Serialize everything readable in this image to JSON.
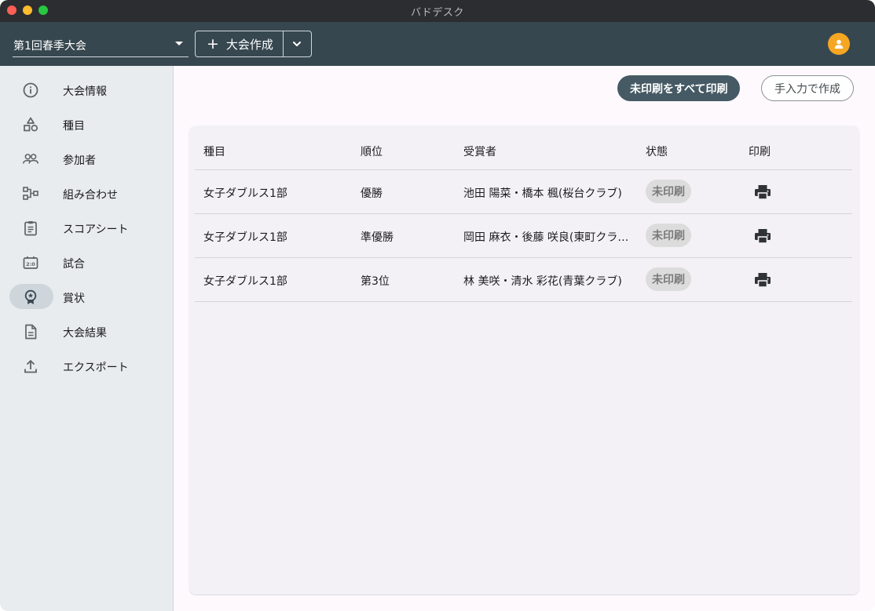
{
  "window": {
    "title": "バドデスク"
  },
  "appbar": {
    "tournament": "第1回春季大会",
    "create_label": "大会作成"
  },
  "sidebar": {
    "items": [
      {
        "label": "大会情報",
        "icon": "info-icon"
      },
      {
        "label": "種目",
        "icon": "shapes-icon"
      },
      {
        "label": "参加者",
        "icon": "people-icon"
      },
      {
        "label": "組み合わせ",
        "icon": "bracket-icon"
      },
      {
        "label": "スコアシート",
        "icon": "clipboard-icon"
      },
      {
        "label": "試合",
        "icon": "scoreboard-icon"
      },
      {
        "label": "賞状",
        "icon": "award-icon",
        "active": true
      },
      {
        "label": "大会結果",
        "icon": "document-icon"
      },
      {
        "label": "エクスポート",
        "icon": "upload-icon"
      }
    ]
  },
  "actions": {
    "print_all": "未印刷をすべて印刷",
    "manual_create": "手入力で作成"
  },
  "table": {
    "headers": [
      "種目",
      "順位",
      "受賞者",
      "状態",
      "印刷"
    ],
    "rows": [
      {
        "event": "女子ダブルス1部",
        "rank": "優勝",
        "winners": "池田 陽菜・橋本 楓(桜台クラブ)",
        "status": "未印刷"
      },
      {
        "event": "女子ダブルス1部",
        "rank": "準優勝",
        "winners": "岡田 麻衣・後藤 咲良(東町クラブ)",
        "status": "未印刷"
      },
      {
        "event": "女子ダブルス1部",
        "rank": "第3位",
        "winners": "林 美咲・清水 彩花(青葉クラブ)",
        "status": "未印刷"
      }
    ]
  },
  "colors": {
    "appbar": "#37474f",
    "sidebar": "#e8ecef",
    "primary_button": "#455a64",
    "avatar": "#f5a623",
    "status_chip": "#dcdcdc"
  }
}
